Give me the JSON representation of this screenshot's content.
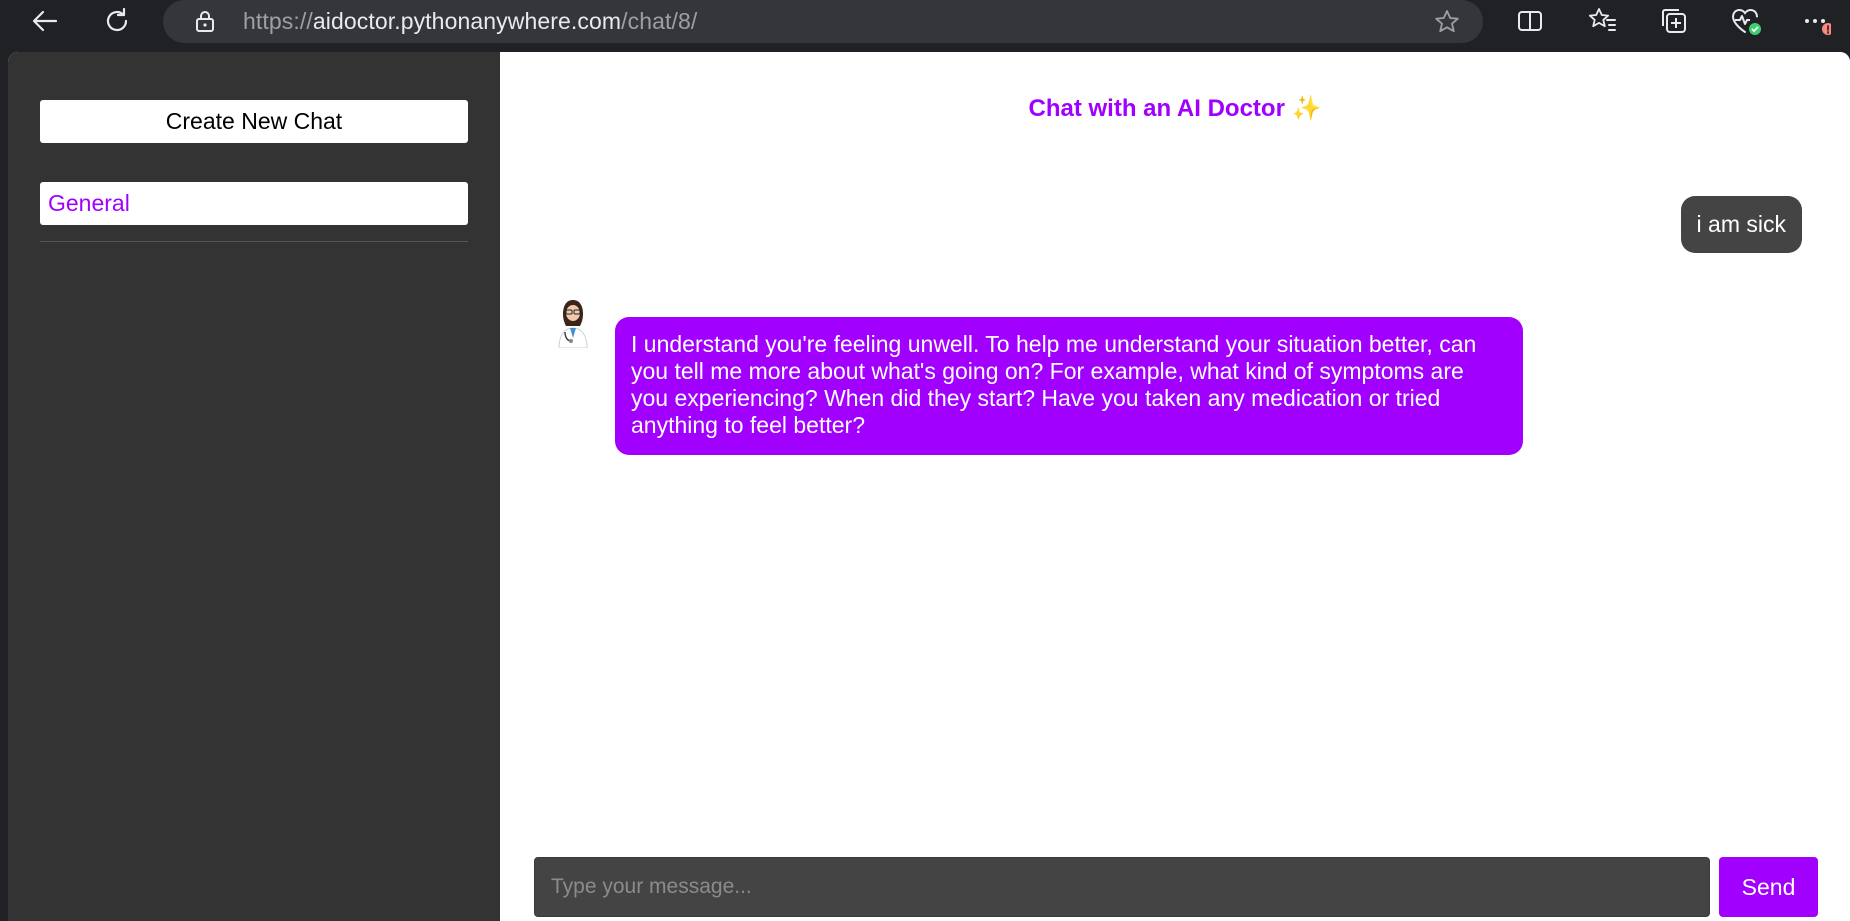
{
  "browser": {
    "url_prefix": "https://",
    "url_host": "aidoctor.pythonanywhere.com",
    "url_path": "/chat/8/",
    "icons": [
      "back-icon",
      "refresh-icon",
      "lock-icon",
      "favorite-star-icon",
      "split-screen-icon",
      "favorites-icon",
      "collections-icon",
      "browser-essentials-icon",
      "more-options-icon"
    ]
  },
  "sidebar": {
    "new_chat_label": "Create New Chat",
    "chats": [
      {
        "label": "General"
      }
    ]
  },
  "chat": {
    "title": "Chat with an AI Doctor",
    "title_emoji": "✨",
    "messages": [
      {
        "role": "user",
        "text": "i am sick"
      },
      {
        "role": "assistant",
        "text": "I understand you're feeling unwell. To help me understand your situation better, can you tell me more about what's going on? For example, what kind of symptoms are you experiencing? When did they start? Have you taken any medication or tried anything to feel better?"
      }
    ],
    "input_placeholder": "Type your message...",
    "input_value": "",
    "send_label": "Send"
  },
  "colors": {
    "accent": "#a100ff",
    "sidebar_bg": "#333333",
    "user_bubble": "#444444",
    "browser_chrome": "#202124"
  }
}
